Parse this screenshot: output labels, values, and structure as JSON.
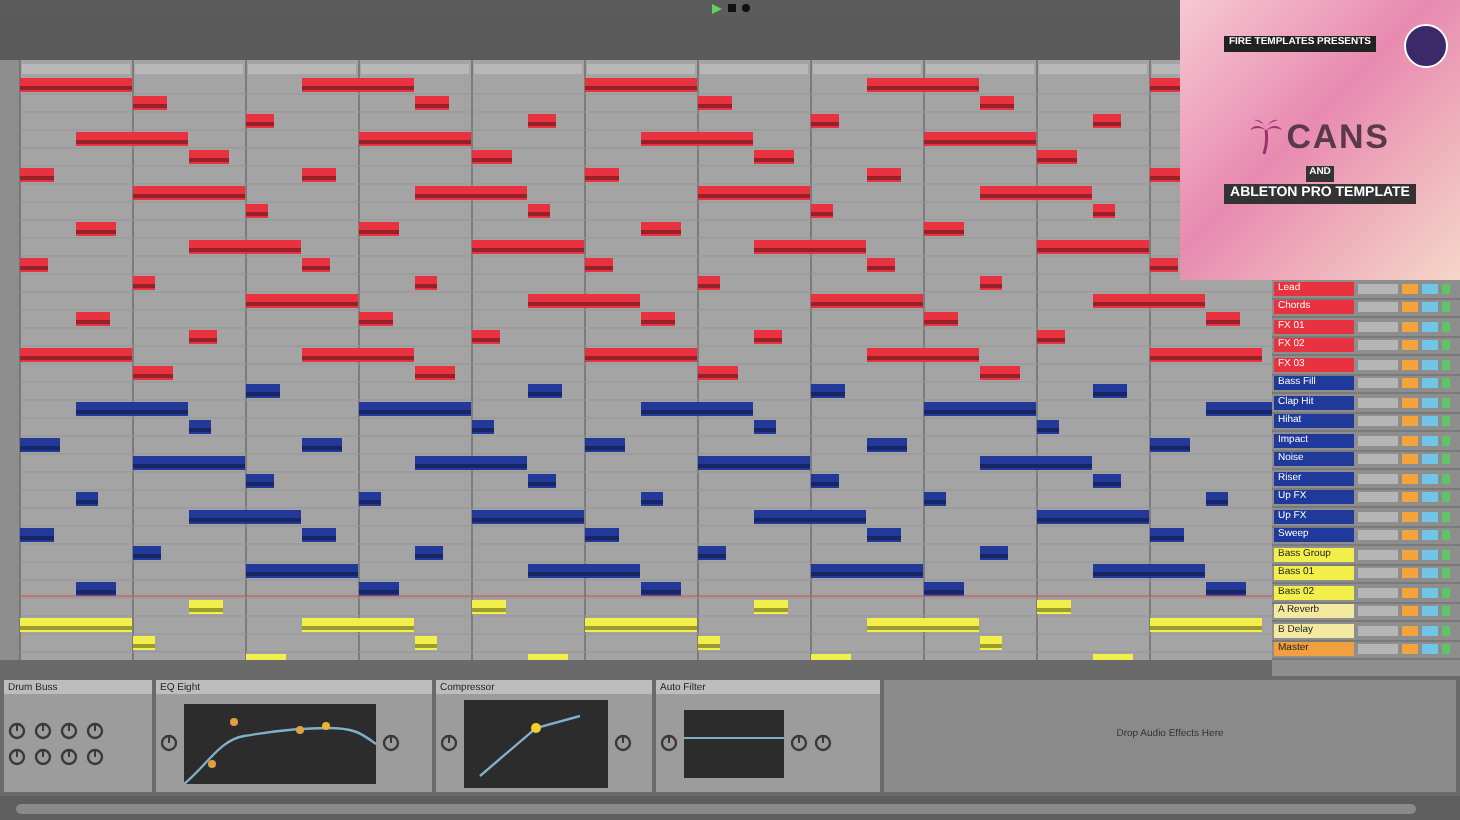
{
  "promo": {
    "presenter": "FIRE TEMPLATES PRESENTS",
    "title": "CANS",
    "joiner": "AND",
    "subtitle": "ABLETON PRO TEMPLATE"
  },
  "tracks": [
    {
      "name": "Lead",
      "color": "#e8323f"
    },
    {
      "name": "Chords",
      "color": "#e8323f"
    },
    {
      "name": "FX 01",
      "color": "#e8323f"
    },
    {
      "name": "FX 02",
      "color": "#e8323f"
    },
    {
      "name": "FX 03",
      "color": "#e8323f"
    },
    {
      "name": "Bass Fill",
      "color": "#1f3a9a"
    },
    {
      "name": "Clap Hit",
      "color": "#1f3a9a"
    },
    {
      "name": "Hihat",
      "color": "#1f3a9a"
    },
    {
      "name": "Impact",
      "color": "#1f3a9a"
    },
    {
      "name": "Noise",
      "color": "#1f3a9a"
    },
    {
      "name": "Riser",
      "color": "#1f3a9a"
    },
    {
      "name": "Up FX",
      "color": "#1f3a9a"
    },
    {
      "name": "Up FX",
      "color": "#1f3a9a"
    },
    {
      "name": "Sweep",
      "color": "#1f3a9a"
    },
    {
      "name": "Bass Group",
      "color": "#f2ee4a"
    },
    {
      "name": "Bass 01",
      "color": "#f2ee4a"
    },
    {
      "name": "Bass 02",
      "color": "#f2ee4a"
    },
    {
      "name": "A Reverb",
      "color": "#f3e9a0"
    },
    {
      "name": "B Delay",
      "color": "#f3e9a0"
    },
    {
      "name": "Master",
      "color": "#f0a040"
    }
  ],
  "devices": [
    {
      "name": "Drum Buss",
      "kind": "knobs"
    },
    {
      "name": "EQ Eight",
      "kind": "eq"
    },
    {
      "name": "Compressor",
      "kind": "comp"
    },
    {
      "name": "Auto Filter",
      "kind": "filter"
    }
  ],
  "drop_hint": "Drop Audio Effects Here"
}
